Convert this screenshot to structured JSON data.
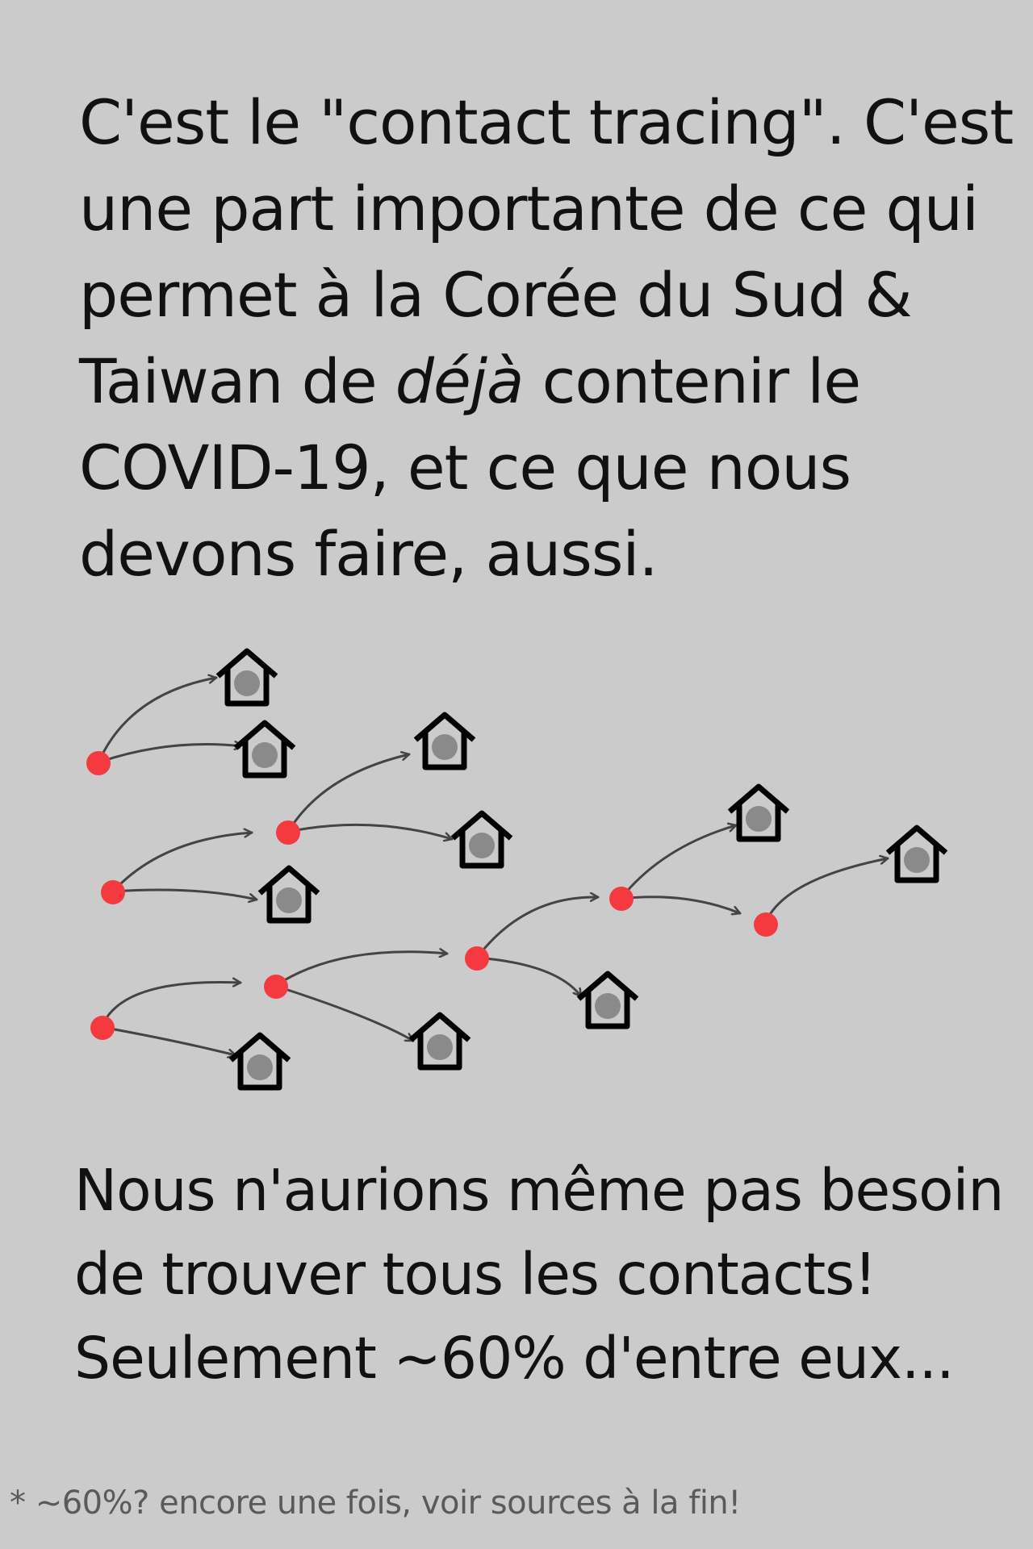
{
  "text": {
    "intro_a": "C'est le \"contact tracing\". C'est une part importante de ce qui permet à la Corée du Sud & Taiwan de ",
    "intro_em": "déjà",
    "intro_b": " contenir le COVID-19, et ce que nous devons faire, aussi.",
    "outro": "Nous n'aurions même pas besoin de trouver tous les contacts! Seulement ~60% d'entre eux...",
    "footnote": "* ~60%? encore une fois, voir sources à la fin!"
  },
  "colors": {
    "background": "#cbcbcb",
    "infected": "#f4393f",
    "house_dot": "#8a8a8a",
    "arrow": "#444444"
  }
}
